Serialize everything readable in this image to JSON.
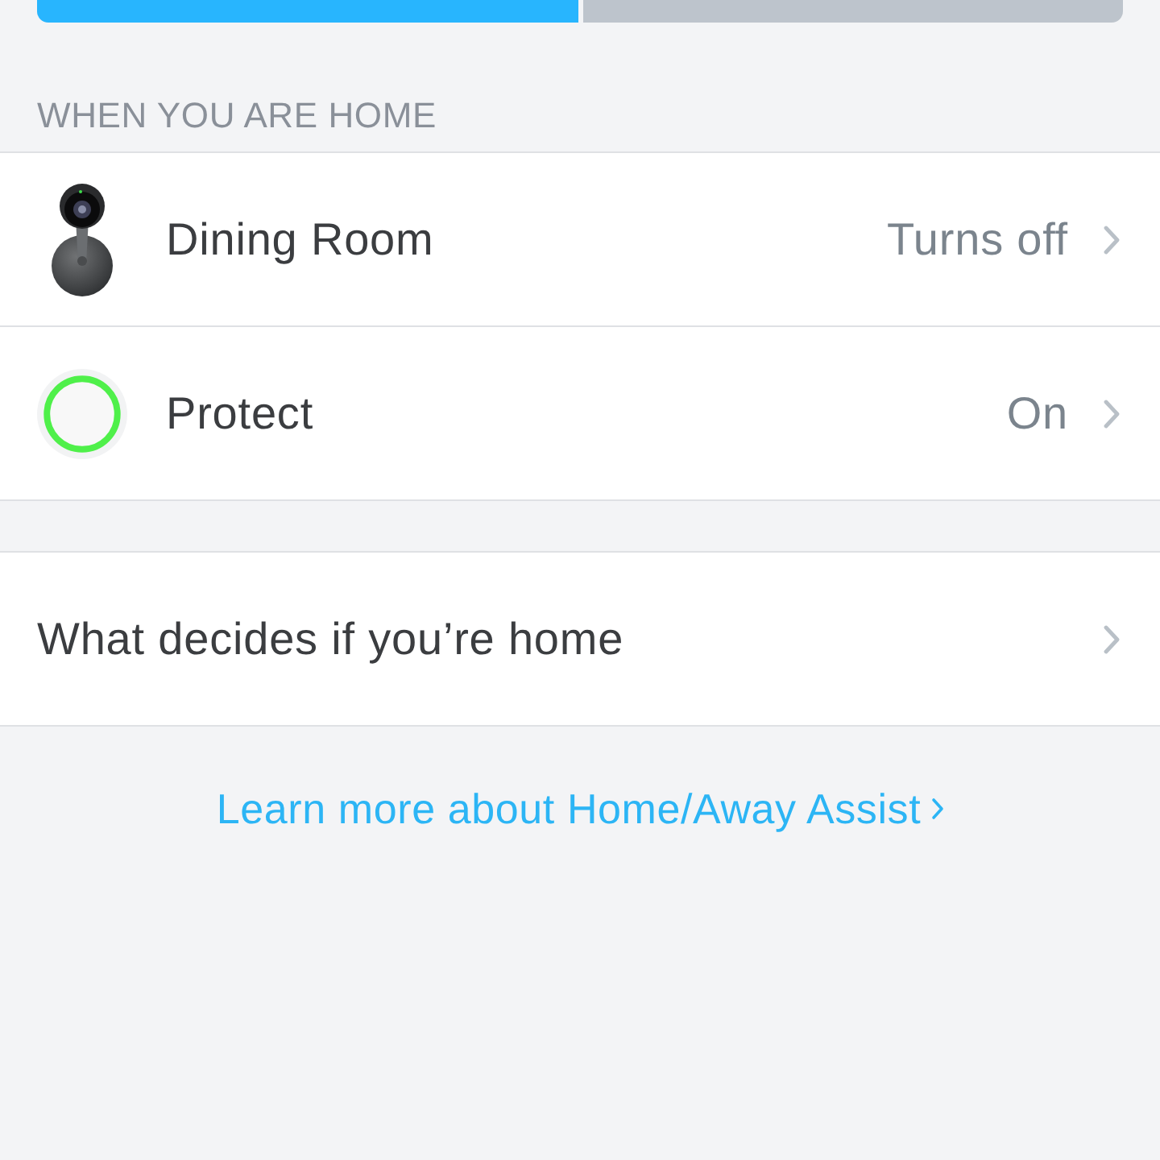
{
  "segmented_control": {
    "segments": [
      {
        "selected": true
      },
      {
        "selected": false
      }
    ]
  },
  "section_header": "WHEN YOU ARE HOME",
  "devices": [
    {
      "kind": "camera",
      "name": "Dining Room",
      "value": "Turns off"
    },
    {
      "kind": "protect",
      "name": "Protect",
      "value": "On"
    }
  ],
  "settings_rows": [
    {
      "label": "What decides if you’re home"
    }
  ],
  "link": {
    "text": "Learn more about Home/Away Assist"
  }
}
